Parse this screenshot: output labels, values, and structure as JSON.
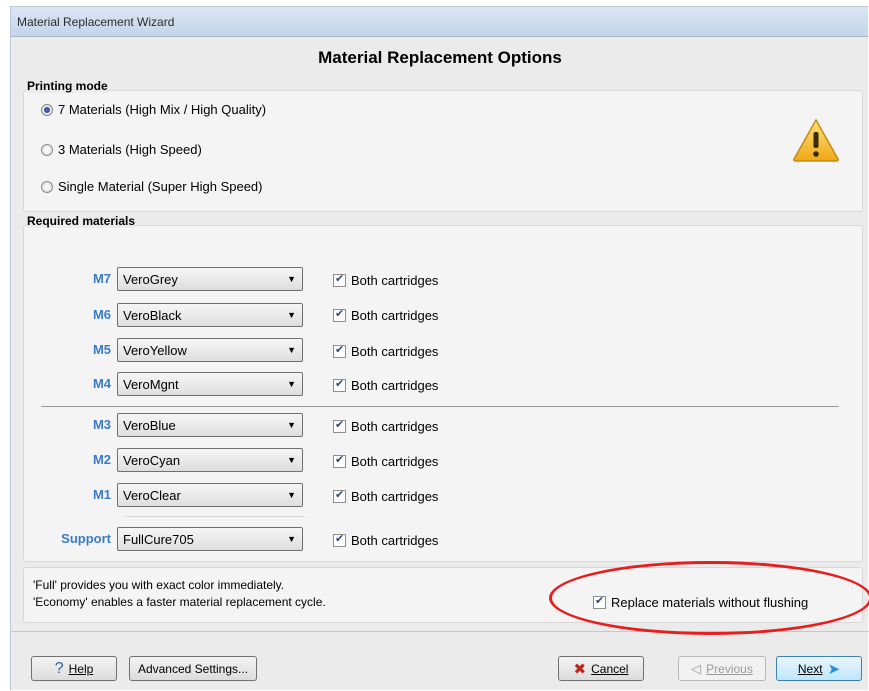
{
  "window": {
    "title": "Material Replacement Wizard"
  },
  "page_title": "Material Replacement Options",
  "printing_mode": {
    "label": "Printing mode",
    "options": [
      {
        "label": "7 Materials (High Mix / High Quality)",
        "selected": true
      },
      {
        "label": "3 Materials (High Speed)",
        "selected": false
      },
      {
        "label": "Single Material (Super High Speed)",
        "selected": false
      }
    ],
    "warning_icon": "warning-triangle-icon"
  },
  "required_materials": {
    "label": "Required materials",
    "rows": [
      {
        "slot": "M7",
        "material": "VeroGrey",
        "both_label": "Both cartridges",
        "both_checked": true
      },
      {
        "slot": "M6",
        "material": "VeroBlack",
        "both_label": "Both cartridges",
        "both_checked": true
      },
      {
        "slot": "M5",
        "material": "VeroYellow",
        "both_label": "Both cartridges",
        "both_checked": true
      },
      {
        "slot": "M4",
        "material": "VeroMgnt",
        "both_label": "Both cartridges",
        "both_checked": true
      },
      {
        "slot": "M3",
        "material": "VeroBlue",
        "both_label": "Both cartridges",
        "both_checked": true
      },
      {
        "slot": "M2",
        "material": "VeroCyan",
        "both_label": "Both cartridges",
        "both_checked": true
      },
      {
        "slot": "M1",
        "material": "VeroClear",
        "both_label": "Both cartridges",
        "both_checked": true
      },
      {
        "slot": "Support",
        "material": "FullCure705",
        "both_label": "Both cartridges",
        "both_checked": true
      }
    ]
  },
  "info": {
    "line1": "'Full' provides you with exact color immediately.",
    "line2": "'Economy' enables a faster material replacement cycle.",
    "replace_label": "Replace materials without flushing",
    "replace_checked": true
  },
  "footer": {
    "help": "Help",
    "advanced": "Advanced Settings...",
    "cancel": "Cancel",
    "previous": "Previous",
    "next": "Next"
  },
  "colors": {
    "slot_label": "#3a7cc8",
    "annotation_oval": "#e81e1e",
    "cancel_icon": "#c0261c",
    "next_arrow": "#2d8fd8"
  }
}
